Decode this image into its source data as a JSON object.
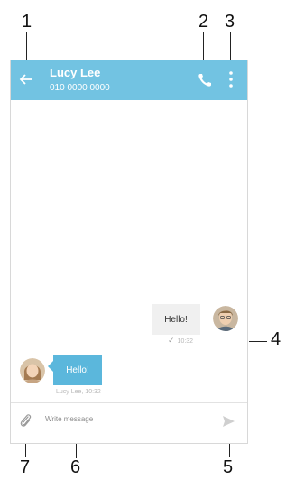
{
  "callouts": {
    "c1": "1",
    "c2": "2",
    "c3": "3",
    "c4": "4",
    "c5": "5",
    "c6": "6",
    "c7": "7"
  },
  "header": {
    "contact_name": "Lucy Lee",
    "phone_number": "010 0000 0000"
  },
  "messages": {
    "outgoing_text": "Hello!",
    "outgoing_meta": "10:32",
    "incoming_text": "Hello!",
    "incoming_meta": "Lucy Lee, 10:32"
  },
  "composer": {
    "placeholder": "Write message"
  },
  "colors": {
    "appbar": "#72c3e2",
    "incoming_bubble": "#5bb7dc",
    "outgoing_bubble": "#f0f0f0"
  },
  "icons": [
    "back-arrow-icon",
    "phone-icon",
    "more-vert-icon",
    "attach-icon",
    "send-icon",
    "check-icon"
  ]
}
